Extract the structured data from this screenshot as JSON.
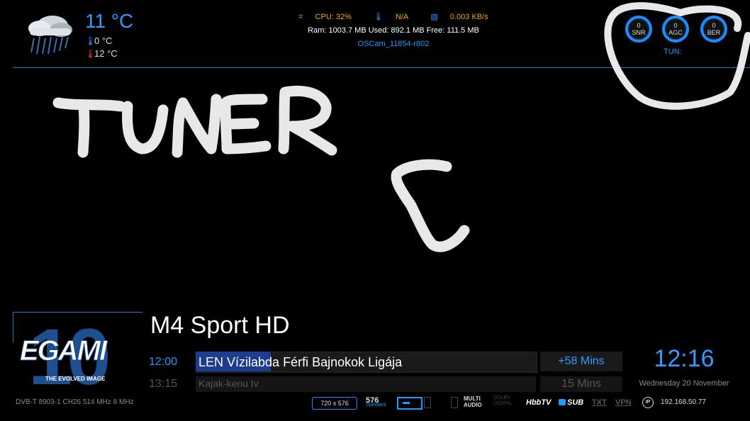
{
  "weather": {
    "icon": "rain-cloud-icon",
    "temperature": "11 °C",
    "low": "0 °C",
    "high": "12 °C"
  },
  "system": {
    "cpu": "CPU:  32%",
    "temp": "N/A",
    "net": "0.003 KB/s",
    "ram": "Ram: 1003.7 MB Used: 892.1 MB Free: 111.5 MB",
    "cam": "OSCam_11854-r802"
  },
  "signal": {
    "gauges": [
      {
        "value": "0",
        "label": "SNR"
      },
      {
        "value": "0",
        "label": "AGC"
      },
      {
        "value": "0",
        "label": "BER"
      }
    ],
    "tuner_label": "TUN:"
  },
  "handwriting": {
    "word1": "TUNER",
    "word2": "C"
  },
  "infobar": {
    "logo_text": "EGAMI",
    "logo_number": "10",
    "logo_tagline": "THE EVOLVED IMAGE",
    "channel": "M4 Sport HD",
    "now": {
      "time": "12:00",
      "title": "LEN Vízilabda Férfi Bajnokok Ligája",
      "remaining": "+58 Mins",
      "progress_fraction": 0.22
    },
    "next": {
      "time": "13:15",
      "title": "Kajak-kenu tv",
      "duration": "15 Mins"
    },
    "clock": "12:16",
    "date": "Wednesday 20 November",
    "tuner_info": "DVB-T 8903-1 CH26 514 MHz 8 MHz"
  },
  "status": {
    "resolution": "720 x 576",
    "res_num": "576",
    "res_label": "Standard",
    "multiaudio": "MULTI AUDIO",
    "dolby": "DOLBY DIGITAL",
    "hbbtv": "HbbTV",
    "sub": "SUB",
    "txt": "TXT",
    "vpn": "VPN",
    "ip_badge": "IP",
    "ip": "192.168.50.77"
  }
}
